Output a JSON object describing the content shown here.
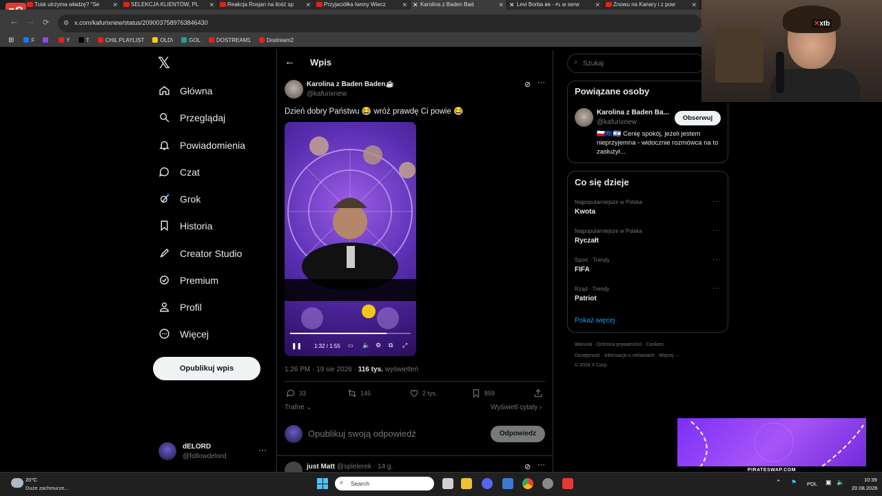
{
  "browser": {
    "tabs": [
      {
        "title": "Tusk utrzyma władzę? \"Se",
        "kind": "yt"
      },
      {
        "title": "SELEKCJA KLIENTÓW, PL",
        "kind": "yt"
      },
      {
        "title": "Reakcja Rosjan na ilość sp",
        "kind": "yt"
      },
      {
        "title": "Przyjaciółka Iwony Wiecz",
        "kind": "yt"
      },
      {
        "title": "Karolina z Baden Bad",
        "kind": "x"
      },
      {
        "title": "Levi Borba ʙʀ - ᴘʟ w serw",
        "kind": "x"
      },
      {
        "title": "Znowu na Kanary i z pow",
        "kind": "yt"
      }
    ],
    "url": "x.com/kafurixnew/status/2090037589763846430",
    "bookmarks": [
      {
        "label": "F",
        "color": "#1877f2"
      },
      {
        "label": "",
        "color": "#9146ff"
      },
      {
        "label": "Y",
        "color": "#e62117"
      },
      {
        "label": "T",
        "color": "#000000"
      },
      {
        "label": "CHIL PLAYLIST",
        "color": "#e62117"
      },
      {
        "label": "OLD\\",
        "color": "#ffcc00"
      },
      {
        "label": "GOL",
        "color": "#2a9d8f"
      },
      {
        "label": "DOSTREAM1",
        "color": "#e62117"
      },
      {
        "label": "Dostream2",
        "color": "#e62117"
      }
    ]
  },
  "nav": {
    "items": [
      {
        "label": "Główna",
        "icon": "home-icon"
      },
      {
        "label": "Przeglądaj",
        "icon": "search-icon"
      },
      {
        "label": "Powiadomienia",
        "icon": "bell-icon"
      },
      {
        "label": "Czat",
        "icon": "chat-icon"
      },
      {
        "label": "Grok",
        "icon": "grok-icon"
      },
      {
        "label": "Historia",
        "icon": "bookmark-icon"
      },
      {
        "label": "Creator Studio",
        "icon": "rocket-icon"
      },
      {
        "label": "Premium",
        "icon": "verified-icon"
      },
      {
        "label": "Profil",
        "icon": "person-icon"
      },
      {
        "label": "Więcej",
        "icon": "more-circle-icon"
      }
    ],
    "post_button": "Opublikuj wpis",
    "account_name": "dELORD",
    "account_handle": "@followdelord"
  },
  "post": {
    "header": "Wpis",
    "author_name": "Karolina z Baden Baden☕",
    "author_handle": "@kafurixnew",
    "text": "Dzień dobry Państwu 😂 wróż prawdę Ci powie 😂",
    "video_time": "1:32 / 1:55",
    "video_progress": 0.8,
    "timestamp": "1:26 PM · 19 sie 2026 · ",
    "views_count": "116 tys.",
    "views_label": " wyświetleń",
    "replies": "33",
    "reposts": "145",
    "likes": "2 tys.",
    "bookmarks": "859",
    "sort_label": "Trafne",
    "quotes_label": "Wyświetl cytaty",
    "reply_placeholder": "Opublikuj swoją odpowiedź",
    "reply_button": "Odpowiedz",
    "next_author": "just Matt",
    "next_handle": "@splelerek · 14 g."
  },
  "sidebar": {
    "search_placeholder": "Szukaj",
    "related_title": "Powiązane osoby",
    "related_name": "Karolina z Baden Ba...",
    "related_handle": "@kafurixnew",
    "follow_label": "Obserwuj",
    "related_bio": "🇵🇱🇪🇺🇮🇱 Cenię spokój, jeżeli jestem nieprzyjemna - widocznie rozmówca na to zasłużył...",
    "trends_title": "Co się dzieje",
    "trends": [
      {
        "category": "Najpopularniejsze w Polska",
        "name": "Kwota"
      },
      {
        "category": "Najpopularniejsze w Polska",
        "name": "Ryczałt"
      },
      {
        "category": "Sport · Trendy",
        "name": "FIFA"
      },
      {
        "category": "Rząd · Trendy",
        "name": "Patriot"
      }
    ],
    "show_more": "Pokaż więcej",
    "footer1": "Warunki  ·  Ochrona prywatności  ·  Cookies  ·",
    "footer2": "Dostępność  ·  Informacje o reklamach  ·  Więcej ···",
    "footer3": "© 2026 X Corp."
  },
  "overlay": {
    "xtb": "xtb",
    "pirateswap": "PIRATESWAP.COM"
  },
  "taskbar": {
    "temperature": "20°C",
    "weather": "Duże zachmurze...",
    "search_placeholder": "Search",
    "language": "POL",
    "time": "10:39",
    "date": "20.08.2026"
  },
  "colors": {
    "accent": "#1d9bf0",
    "background": "#000000",
    "border": "#2f3336"
  }
}
